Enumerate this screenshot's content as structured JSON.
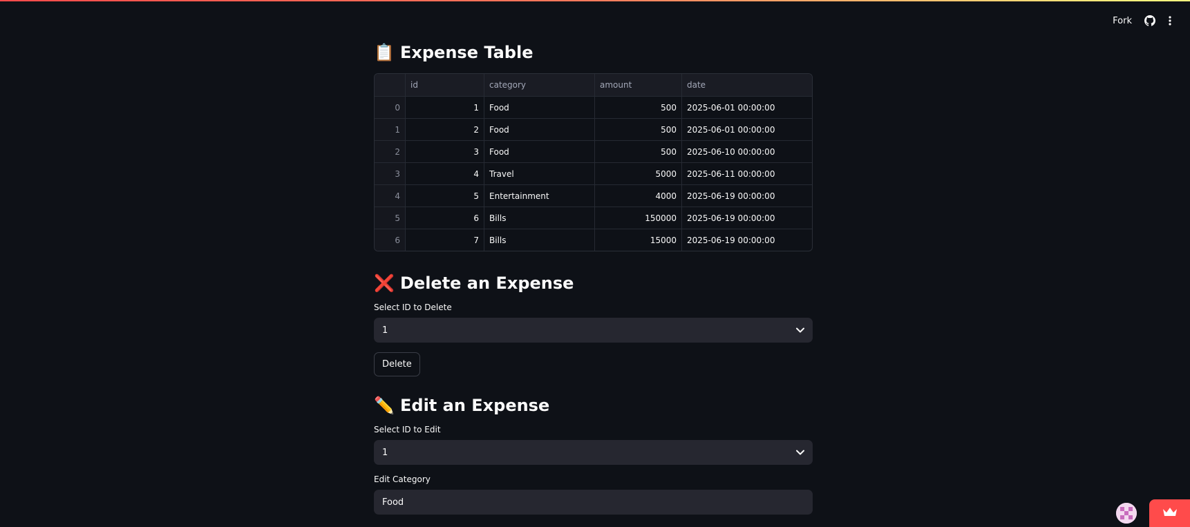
{
  "header": {
    "fork_label": "Fork",
    "github_icon": "github-icon",
    "menu_icon": "more-vertical-icon"
  },
  "expense_table": {
    "emoji": "📋",
    "title": "Expense Table",
    "columns": [
      "",
      "id",
      "category",
      "amount",
      "date"
    ],
    "rows": [
      {
        "index": "0",
        "id": "1",
        "category": "Food",
        "amount": "500",
        "date": "2025-06-01 00:00:00"
      },
      {
        "index": "1",
        "id": "2",
        "category": "Food",
        "amount": "500",
        "date": "2025-06-01 00:00:00"
      },
      {
        "index": "2",
        "id": "3",
        "category": "Food",
        "amount": "500",
        "date": "2025-06-10 00:00:00"
      },
      {
        "index": "3",
        "id": "4",
        "category": "Travel",
        "amount": "5000",
        "date": "2025-06-11 00:00:00"
      },
      {
        "index": "4",
        "id": "5",
        "category": "Entertainment",
        "amount": "4000",
        "date": "2025-06-19 00:00:00"
      },
      {
        "index": "5",
        "id": "6",
        "category": "Bills",
        "amount": "150000",
        "date": "2025-06-19 00:00:00"
      },
      {
        "index": "6",
        "id": "7",
        "category": "Bills",
        "amount": "15000",
        "date": "2025-06-19 00:00:00"
      }
    ]
  },
  "delete_section": {
    "emoji": "❌",
    "title": "Delete an Expense",
    "select_label": "Select ID to Delete",
    "select_value": "1",
    "button_label": "Delete"
  },
  "edit_section": {
    "emoji": "✏️",
    "title": "Edit an Expense",
    "select_label": "Select ID to Edit",
    "select_value": "1",
    "category_label": "Edit Category",
    "category_value": "Food"
  },
  "colors": {
    "background": "#0e1117",
    "accent": "#ff4b4b",
    "input_bg": "#262730"
  }
}
